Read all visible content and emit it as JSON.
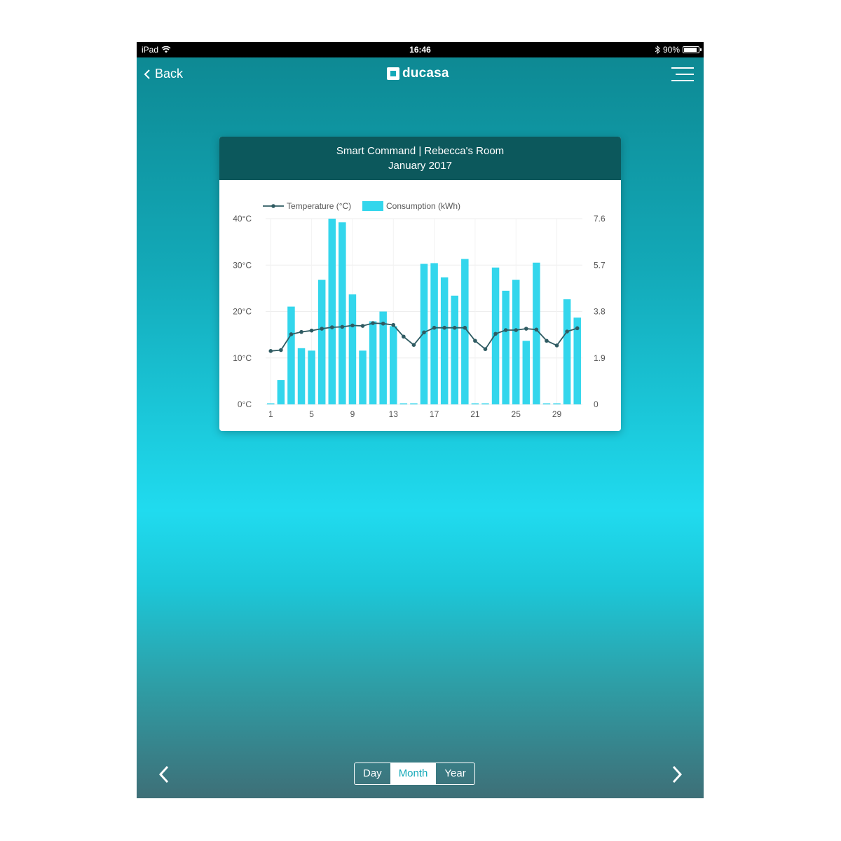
{
  "status_bar": {
    "device": "iPad",
    "time": "16:46",
    "battery": "90%",
    "battery_level": 0.9
  },
  "nav": {
    "back_label": "Back",
    "logo_text": "ducasa"
  },
  "card": {
    "title": "Smart Command | Rebecca's Room",
    "subtitle": "January 2017"
  },
  "chart_data": {
    "type": "bar",
    "title": "Smart Command | Rebecca's Room",
    "subtitle": "January 2017",
    "x": [
      1,
      2,
      3,
      4,
      5,
      6,
      7,
      8,
      9,
      10,
      11,
      12,
      13,
      14,
      15,
      16,
      17,
      18,
      19,
      20,
      21,
      22,
      23,
      24,
      25,
      26,
      27,
      28,
      29,
      30,
      31
    ],
    "x_tick_labels": [
      "1",
      "5",
      "9",
      "13",
      "17",
      "21",
      "25",
      "29"
    ],
    "x_tick_positions": [
      1,
      5,
      9,
      13,
      17,
      21,
      25,
      29
    ],
    "y_left": {
      "tick_labels": [
        "0°C",
        "10°C",
        "20°C",
        "30°C",
        "40°C"
      ],
      "range": [
        0,
        40
      ]
    },
    "y_right": {
      "tick_labels": [
        "0",
        "1.9",
        "3.8",
        "5.7",
        "7.6"
      ],
      "range": [
        0,
        7.6
      ]
    },
    "grid": true,
    "legend": "top-left",
    "series": [
      {
        "name": "Temperature (°C)",
        "type": "line",
        "axis": "left",
        "color": "#2f5b62",
        "values": [
          11.5,
          11.7,
          15.1,
          15.6,
          15.9,
          16.3,
          16.6,
          16.7,
          17,
          16.9,
          17.5,
          17.4,
          17.1,
          14.6,
          12.8,
          15.5,
          16.5,
          16.5,
          16.5,
          16.5,
          13.7,
          11.9,
          15.2,
          16,
          16,
          16.3,
          16.1,
          13.7,
          12.7,
          15.7,
          16.4
        ]
      },
      {
        "name": "Consumption (kWh)",
        "type": "bar",
        "axis": "right",
        "color": "#33d6ec",
        "values": [
          0,
          1.0,
          4.0,
          2.3,
          2.2,
          5.1,
          7.6,
          7.45,
          4.5,
          2.2,
          3.4,
          3.8,
          3.2,
          0,
          0,
          5.75,
          5.78,
          5.2,
          4.45,
          5.95,
          0,
          0,
          5.6,
          4.65,
          5.1,
          2.6,
          5.8,
          0,
          0,
          4.3,
          3.55
        ]
      }
    ]
  },
  "range_selector": {
    "options": [
      "Day",
      "Month",
      "Year"
    ],
    "selected": "Month"
  },
  "colors": {
    "accent": "#13a9b8",
    "header": "#0c585c",
    "bar": "#33d6ec",
    "line": "#2f5b62"
  }
}
